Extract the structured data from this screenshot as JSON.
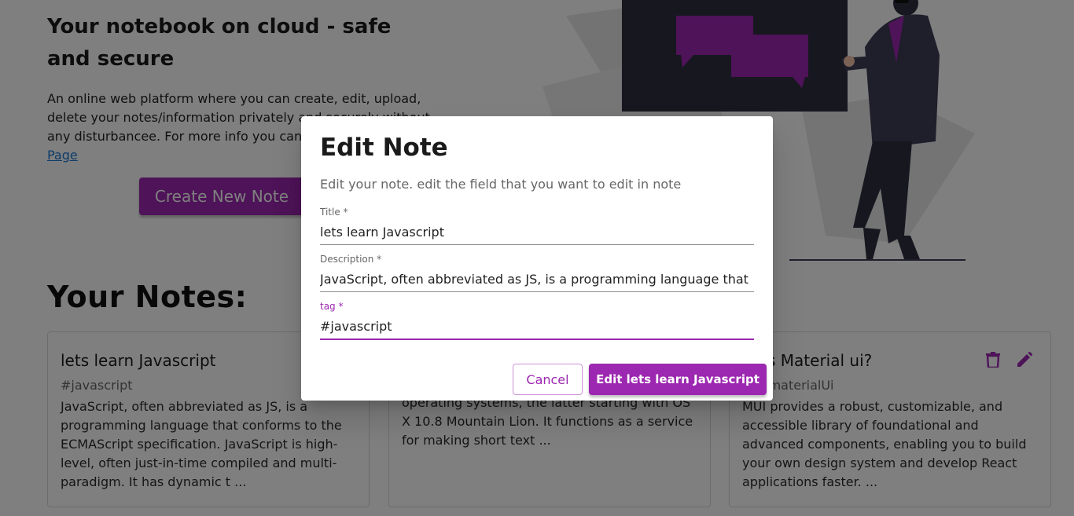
{
  "hero": {
    "title": "Your notebook on cloud - safe and secure",
    "description": "An online web platform where you can create, edit, upload, delete your notes/information privately and securely without any disturbancee. For more info you can",
    "link": "Page",
    "create_button": "Create New Note"
  },
  "notes": {
    "heading": "Your Notes:",
    "cards": [
      {
        "title": "lets learn Javascript",
        "tag": "#javascript",
        "description": "JavaScript, often abbreviated as JS, is a programming language that conforms to the ECMAScript specification. JavaScript is high-level, often just-in-time compiled and multi-paradigm. It has dynamic t ..."
      },
      {
        "title": "",
        "tag": "",
        "description": "Notes is a notetaking app developed by Apple. It is provided on their iOS and macOS operating systems, the latter starting with OS X 10.8 Mountain Lion. It functions as a service for making short text ..."
      },
      {
        "title": "at is Material ui?",
        "tag": "ct #materialUi",
        "description": "MUI provides a robust, customizable, and accessible library of foundational and advanced components, enabling you to build your own design system and develop React applications faster. ..."
      }
    ]
  },
  "dialog": {
    "title": "Edit Note",
    "subtitle": "Edit your note. edit the field that you want to edit in note",
    "fields": {
      "title_label": "Title *",
      "title_value": "lets learn Javascript",
      "description_label": "Description *",
      "description_value": "JavaScript, often abbreviated as JS, is a programming language that",
      "tag_label": "tag *",
      "tag_value": "#javascript"
    },
    "cancel_label": "Cancel",
    "save_label": "Edit lets learn Javascript"
  },
  "colors": {
    "accent": "#9c27b0",
    "backdrop": "rgba(0,0,0,0.5)",
    "link": "#1976d2"
  },
  "icons": [
    "delete-icon",
    "edit-icon"
  ]
}
